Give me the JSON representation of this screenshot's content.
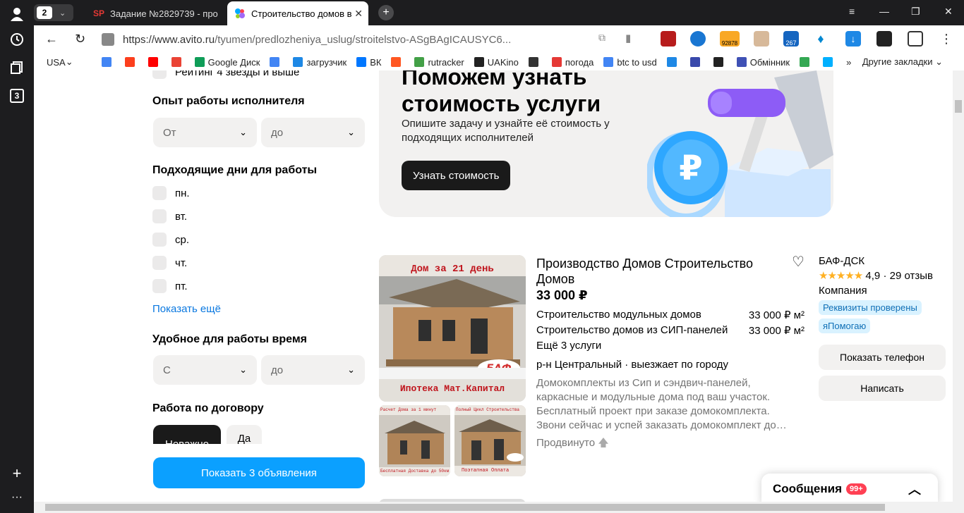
{
  "browser": {
    "tab_count": "2",
    "tabs": [
      {
        "favicon_text": "SP",
        "title": "Задание №2829739 - про"
      },
      {
        "favicon_text": "",
        "title": "Строительство домов в"
      }
    ],
    "rail_badge": "3",
    "url_host": "https://www.avito.ru",
    "url_path": "/tyumen/predlozheniya_uslug/stroitelstvo-ASgBAgICAUSYC6...",
    "extension_badge": "92878",
    "extension_badge_2": "267",
    "bookmarks": [
      {
        "label": "USA",
        "icon": "chevron-down-icon",
        "color": "#ffffff"
      },
      {
        "label": "",
        "icon": "google-icon",
        "color": "#4285f4"
      },
      {
        "label": "",
        "icon": "yandex-icon",
        "color": "#fc3f1d"
      },
      {
        "label": "",
        "icon": "youtube-icon",
        "color": "#ff0000"
      },
      {
        "label": "",
        "icon": "gmail-icon",
        "color": "#ea4335"
      },
      {
        "label": "Google Диск",
        "icon": "google-drive-icon",
        "color": "#0f9d58"
      },
      {
        "label": "",
        "icon": "translate-icon",
        "color": "#4285f4"
      },
      {
        "label": "загрузчик",
        "icon": "loader-icon",
        "color": "#1e88e5"
      },
      {
        "label": "ВК",
        "icon": "vk-icon",
        "color": "#0077ff"
      },
      {
        "label": "",
        "icon": "f-icon",
        "color": "#ff5722"
      },
      {
        "label": "rutracker",
        "icon": "rutracker-icon",
        "color": "#43a047"
      },
      {
        "label": "UAKino",
        "icon": "uakino-icon",
        "color": "#222222"
      },
      {
        "label": "",
        "icon": "person-icon",
        "color": "#333333"
      },
      {
        "label": "погода",
        "icon": "thermometer-icon",
        "color": "#e53935"
      },
      {
        "label": "btc to usd",
        "icon": "google-icon",
        "color": "#4285f4"
      },
      {
        "label": "",
        "icon": "p-icon",
        "color": "#1e88e5"
      },
      {
        "label": "",
        "icon": "arrow-icon",
        "color": "#3949ab"
      },
      {
        "label": "",
        "icon": "bc-icon",
        "color": "#222222"
      },
      {
        "label": "Обмінник",
        "icon": "exchange-icon",
        "color": "#3f51b5"
      },
      {
        "label": "",
        "icon": "maps-icon",
        "color": "#34a853"
      },
      {
        "label": "",
        "icon": "star-icon",
        "color": "#00b0ff"
      }
    ],
    "bookmarks_more": "»",
    "other_bookmarks": "Другие закладки"
  },
  "filters": {
    "rating_label": "Рейтинг 4 звезды и выше",
    "experience_title": "Опыт работы исполнителя",
    "experience_from": "От",
    "experience_to": "до",
    "days_title": "Подходящие дни для работы",
    "days": [
      "пн.",
      "вт.",
      "ср.",
      "чт.",
      "пт."
    ],
    "show_more": "Показать ещё",
    "time_title": "Удобное для работы время",
    "time_from": "С",
    "time_to": "до",
    "contract_title": "Работа по договору",
    "contract_options": [
      "Неважно",
      "Да"
    ],
    "show_button": "Показать 3 объявления"
  },
  "banner": {
    "title": "Поможем узнать стоимость услуги",
    "subtitle": "Опишите задачу и узнайте её стоимость у подходящих исполнителей",
    "cta": "Узнать стоимость",
    "coin_symbol": "₽"
  },
  "listing": {
    "photo_top_caption": "Дом за 21 день",
    "photo_bottom_caption": "Ипотека Мат.Капитал",
    "photo_logo": "БАФ",
    "thumb1_top": "Расчет Дома за 1 минут",
    "thumb1_bottom": "Бесплатная Доставка до 50км",
    "thumb2_top": "Полный Цикл Строительства",
    "thumb2_bottom": "Поэтапная Оплата",
    "title": "Производство Домов Строительство Домов",
    "price": "33 000 ₽",
    "services": [
      {
        "name": "Строительство модульных домов",
        "price": "33 000 ₽ м²"
      },
      {
        "name": "Строительство домов из СИП-панелей",
        "price": "33 000 ₽ м²"
      }
    ],
    "more_services": "Ещё 3 услуги",
    "location": "р-н Центральный · выезжает по городу",
    "description": "Домокомплекты из Сип и сэндвич-панелей, каркасные и модульные дома под ваш участок. Бесплатный проект при заказе домокомплекта. Звони сейчас и успей заказать домокомплект до…",
    "promoted": "Продвинуто"
  },
  "seller": {
    "name": "БАФ-ДСК",
    "stars": "★★★★★",
    "rating": "4,9 · 29 отзыв",
    "kind": "Компания",
    "badges": [
      "Реквизиты проверены",
      "яПомогаю"
    ],
    "phone_button": "Показать телефон",
    "write_button": "Написать"
  },
  "messages": {
    "label": "Сообщения",
    "count": "99+"
  }
}
